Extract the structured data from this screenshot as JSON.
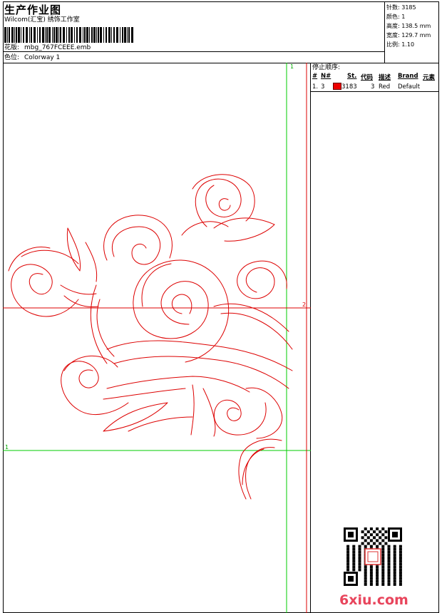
{
  "header": {
    "title": "生产作业图",
    "subtitle": "Wilcom(汇宝) 绣饰工作室",
    "design_label": "花版:",
    "design_value": "mbg_767FCEEE.emb",
    "color_label": "色位:",
    "color_value": "Colorway 1"
  },
  "specs": [
    {
      "label": "针数:",
      "value": "3185"
    },
    {
      "label": "颜色:",
      "value": "1"
    },
    {
      "label": "高度:",
      "value": "138.5 mm"
    },
    {
      "label": "宽度:",
      "value": "129.7 mm"
    },
    {
      "label": "比例:",
      "value": "1.10"
    }
  ],
  "stop_sequence": {
    "title": "停止顺序:",
    "columns": [
      "#",
      "N#",
      "St.",
      "代码",
      "描述",
      "Brand",
      "元素"
    ],
    "rows": [
      {
        "index": "1.",
        "needle": "3",
        "color": "#e00000",
        "stitches": "3183",
        "code": "3",
        "desc": "Red",
        "brand": "Default"
      }
    ]
  },
  "canvas": {
    "marker_top": "1",
    "marker_left": "1",
    "marker_right": "2",
    "guide_color": "#00cc00",
    "crosshair_color": "#dd0000",
    "stitch_color": "#dd0000"
  },
  "watermark": "6xiu.com"
}
